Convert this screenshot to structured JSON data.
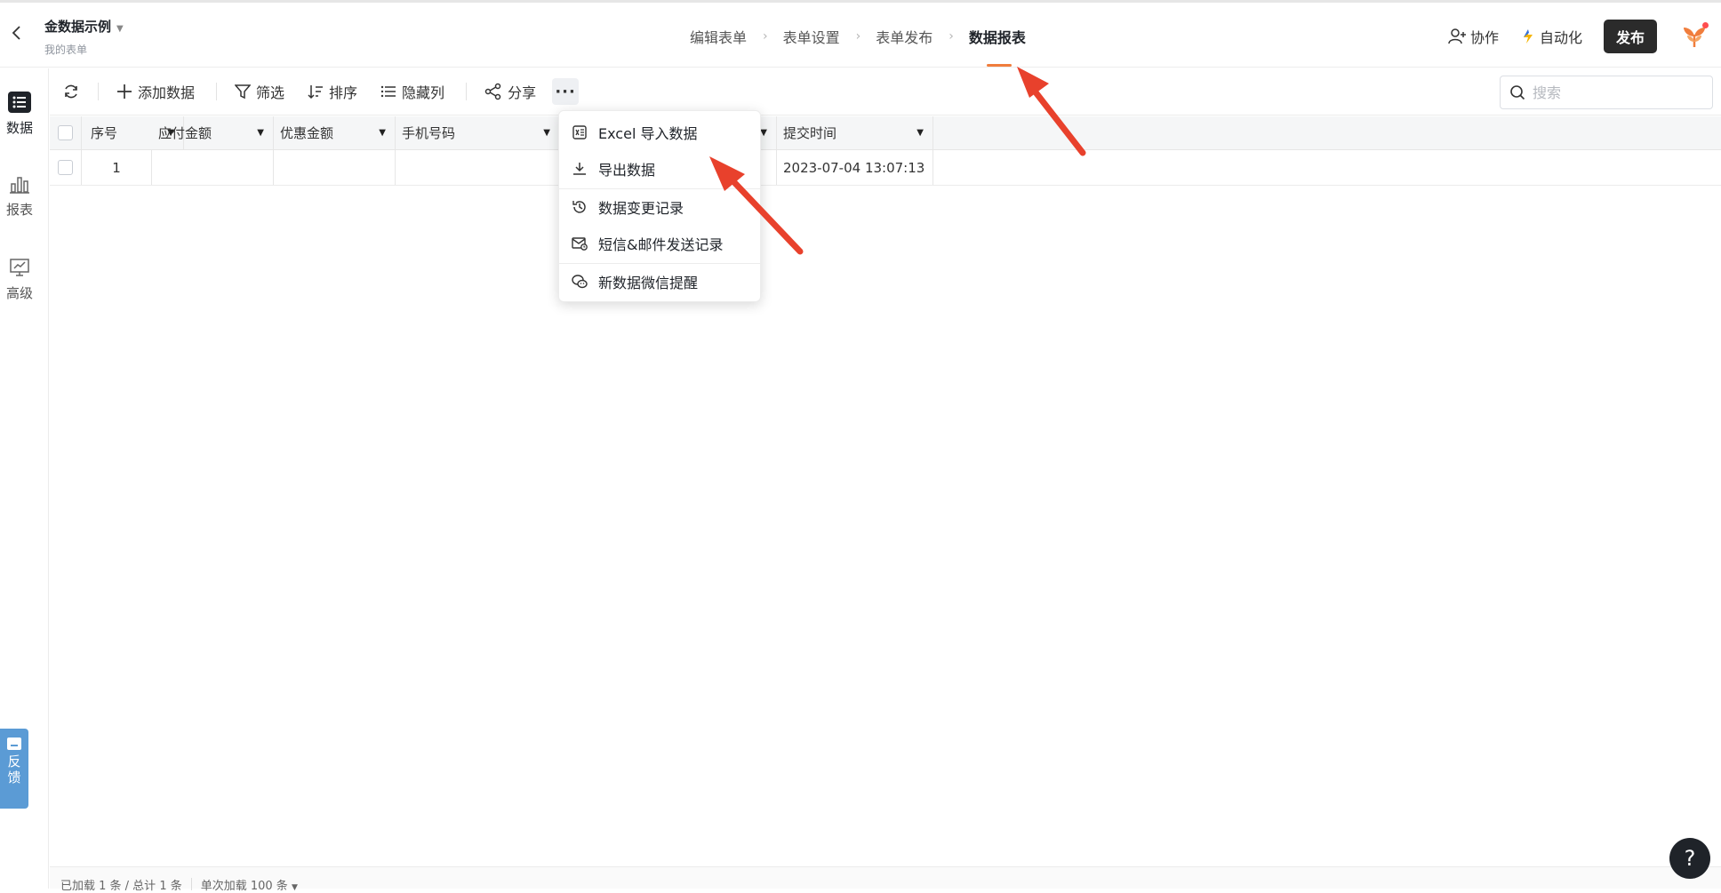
{
  "header": {
    "title": "金数据示例",
    "subtitle": "我的表单",
    "steps": [
      "编辑表单",
      "表单设置",
      "表单发布",
      "数据报表"
    ],
    "collab_label": "协作",
    "automation_label": "自动化",
    "publish_label": "发布"
  },
  "leftnav": {
    "items": [
      {
        "label": "数据",
        "icon": "list-icon"
      },
      {
        "label": "报表",
        "icon": "bar-chart-icon"
      },
      {
        "label": "高级",
        "icon": "monitor-chart-icon"
      }
    ],
    "feedback_label": "反馈"
  },
  "toolbar": {
    "add_label": "添加数据",
    "filter_label": "筛选",
    "sort_label": "排序",
    "hide_label": "隐藏列",
    "share_label": "分享",
    "more_label": "···",
    "search_placeholder": "搜索"
  },
  "table": {
    "columns": [
      "序号",
      "应付金额",
      "优惠金额",
      "手机号码",
      "",
      "提交时间"
    ],
    "rows": [
      [
        "1",
        "",
        "",
        "",
        "",
        "2023-07-04 13:07:13"
      ]
    ]
  },
  "menu": {
    "items": [
      {
        "label": "Excel 导入数据",
        "icon": "excel-import-icon"
      },
      {
        "label": "导出数据",
        "icon": "download-icon"
      },
      {
        "label": "数据变更记录",
        "icon": "history-icon"
      },
      {
        "label": "短信&邮件发送记录",
        "icon": "mail-icon"
      },
      {
        "label": "新数据微信提醒",
        "icon": "wechat-icon"
      }
    ]
  },
  "footer": {
    "loaded_text": "已加载 1 条 / 总计 1 条",
    "per_load_text": "单次加载 100 条"
  },
  "help_label": "?",
  "colors": {
    "accent": "#f07d3c",
    "publish_bg": "#2b2b2b",
    "annotation_arrow": "#e8412c",
    "feedback_bg": "#5b9bd5"
  }
}
